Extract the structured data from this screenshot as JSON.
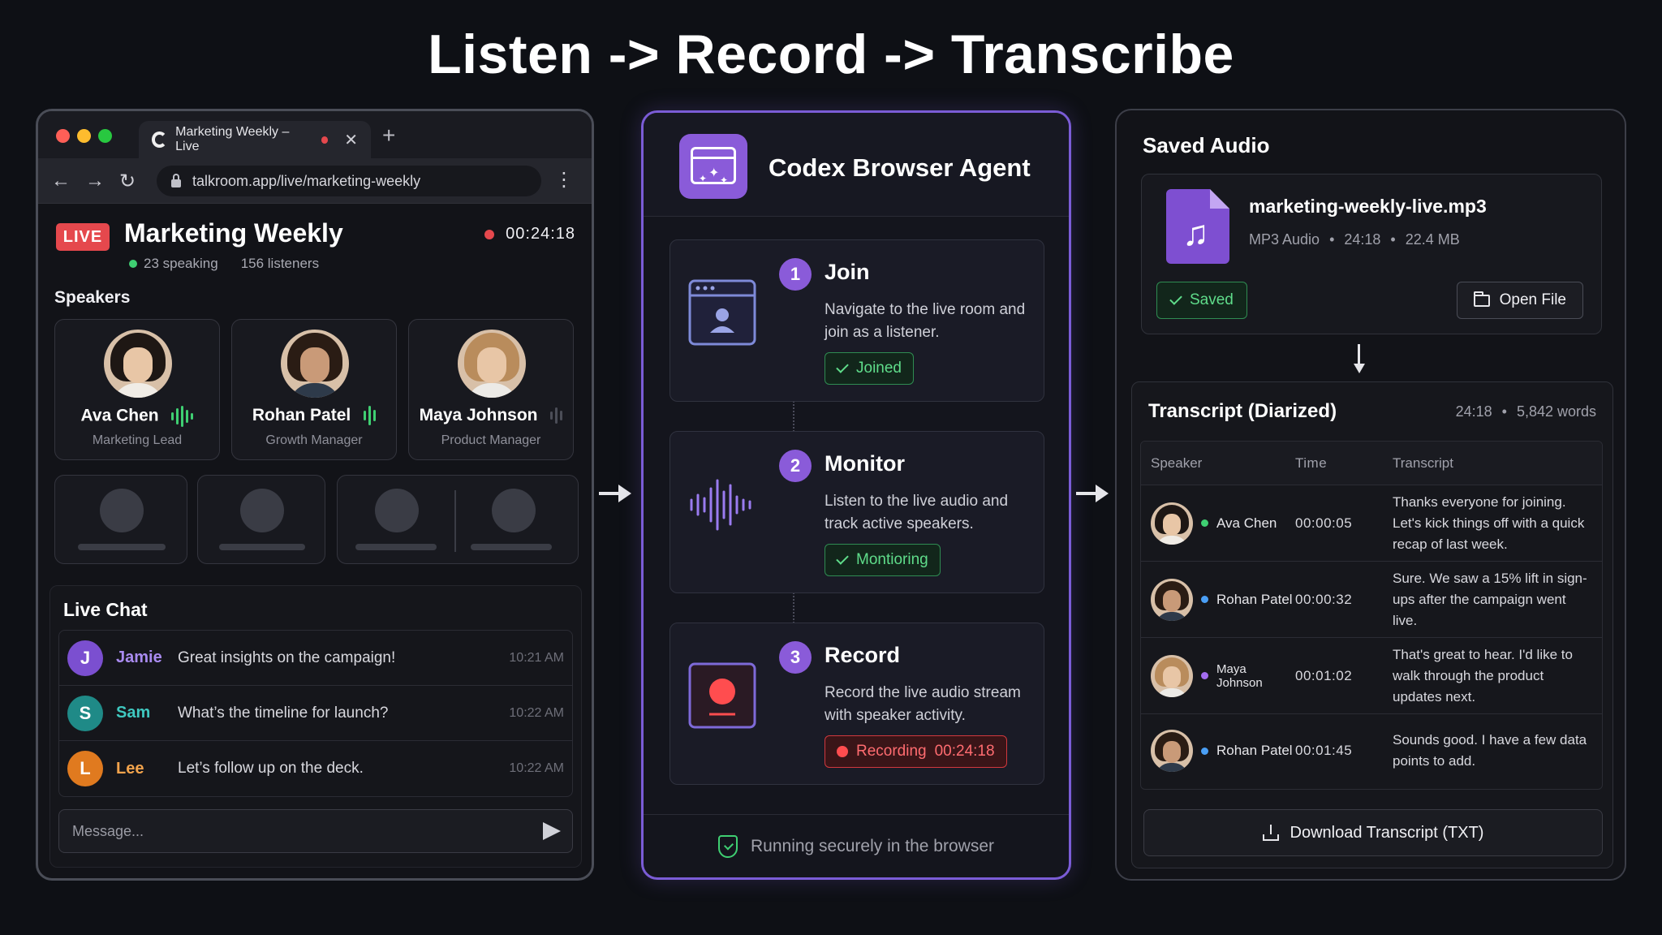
{
  "headline": "Listen -> Record -> Transcribe",
  "browser": {
    "tab_title": "Marketing Weekly – Live",
    "url": "talkroom.app/live/marketing-weekly",
    "room": {
      "badge": "LIVE",
      "title": "Marketing Weekly",
      "speaking": "23 speaking",
      "listeners": "156 listeners",
      "timer": "00:24:18"
    },
    "speakers_label": "Speakers",
    "speakers": [
      {
        "name": "Ava Chen",
        "role": "Marketing Lead",
        "active": true
      },
      {
        "name": "Rohan Patel",
        "role": "Growth Manager",
        "active": true
      },
      {
        "name": "Maya Johnson",
        "role": "Product Manager",
        "active": false
      }
    ],
    "chat": {
      "title": "Live Chat",
      "messages": [
        {
          "initial": "J",
          "name": "Jamie",
          "text": "Great insights on the campaign!",
          "time": "10:21 AM",
          "color": "#7b4fd0"
        },
        {
          "initial": "S",
          "name": "Sam",
          "text": "What’s the timeline for launch?",
          "time": "10:22 AM",
          "color": "#1f8a87"
        },
        {
          "initial": "L",
          "name": "Lee",
          "text": "Let’s follow up on the deck.",
          "time": "10:22 AM",
          "color": "#e07a1f"
        }
      ],
      "input_placeholder": "Message..."
    }
  },
  "agent": {
    "title": "Codex Browser Agent",
    "steps": [
      {
        "num": "1",
        "title": "Join",
        "desc": "Navigate to the live room and join as a listener.",
        "status": "Joined"
      },
      {
        "num": "2",
        "title": "Monitor",
        "desc": "Listen to the live audio and track active speakers.",
        "status": "Montioring"
      },
      {
        "num": "3",
        "title": "Record",
        "desc": "Record the live audio stream with speaker activity.",
        "status": "Recording",
        "status_time": "00:24:18"
      }
    ],
    "footer": "Running securely in the browser"
  },
  "saved": {
    "title": "Saved Audio",
    "file_name": "marketing-weekly-live.mp3",
    "file_type": "MP3 Audio",
    "duration": "24:18",
    "size": "22.4 MB",
    "saved_label": "Saved",
    "open_label": "Open File"
  },
  "transcript": {
    "title": "Transcript (Diarized)",
    "duration": "24:18",
    "words": "5,842 words",
    "columns": [
      "Speaker",
      "Time",
      "Transcript"
    ],
    "rows": [
      {
        "speaker": "Ava Chen",
        "time": "00:00:05",
        "text": "Thanks everyone for joining. Let's kick things off with a quick recap of last week.",
        "dot": "#3fcf72"
      },
      {
        "speaker": "Rohan Patel",
        "time": "00:00:32",
        "text": "Sure. We saw a 15% lift in sign-ups after the campaign went live.",
        "dot": "#4a9ff5"
      },
      {
        "speaker": "Maya Johnson",
        "time": "00:01:02",
        "text": "That's great to hear. I'd like to walk through the product updates next.",
        "dot": "#a36cf0"
      },
      {
        "speaker": "Rohan Patel",
        "time": "00:01:45",
        "text": "Sounds good. I have a few data points to add.",
        "dot": "#4a9ff5"
      }
    ],
    "download_label": "Download Transcript (TXT)"
  }
}
